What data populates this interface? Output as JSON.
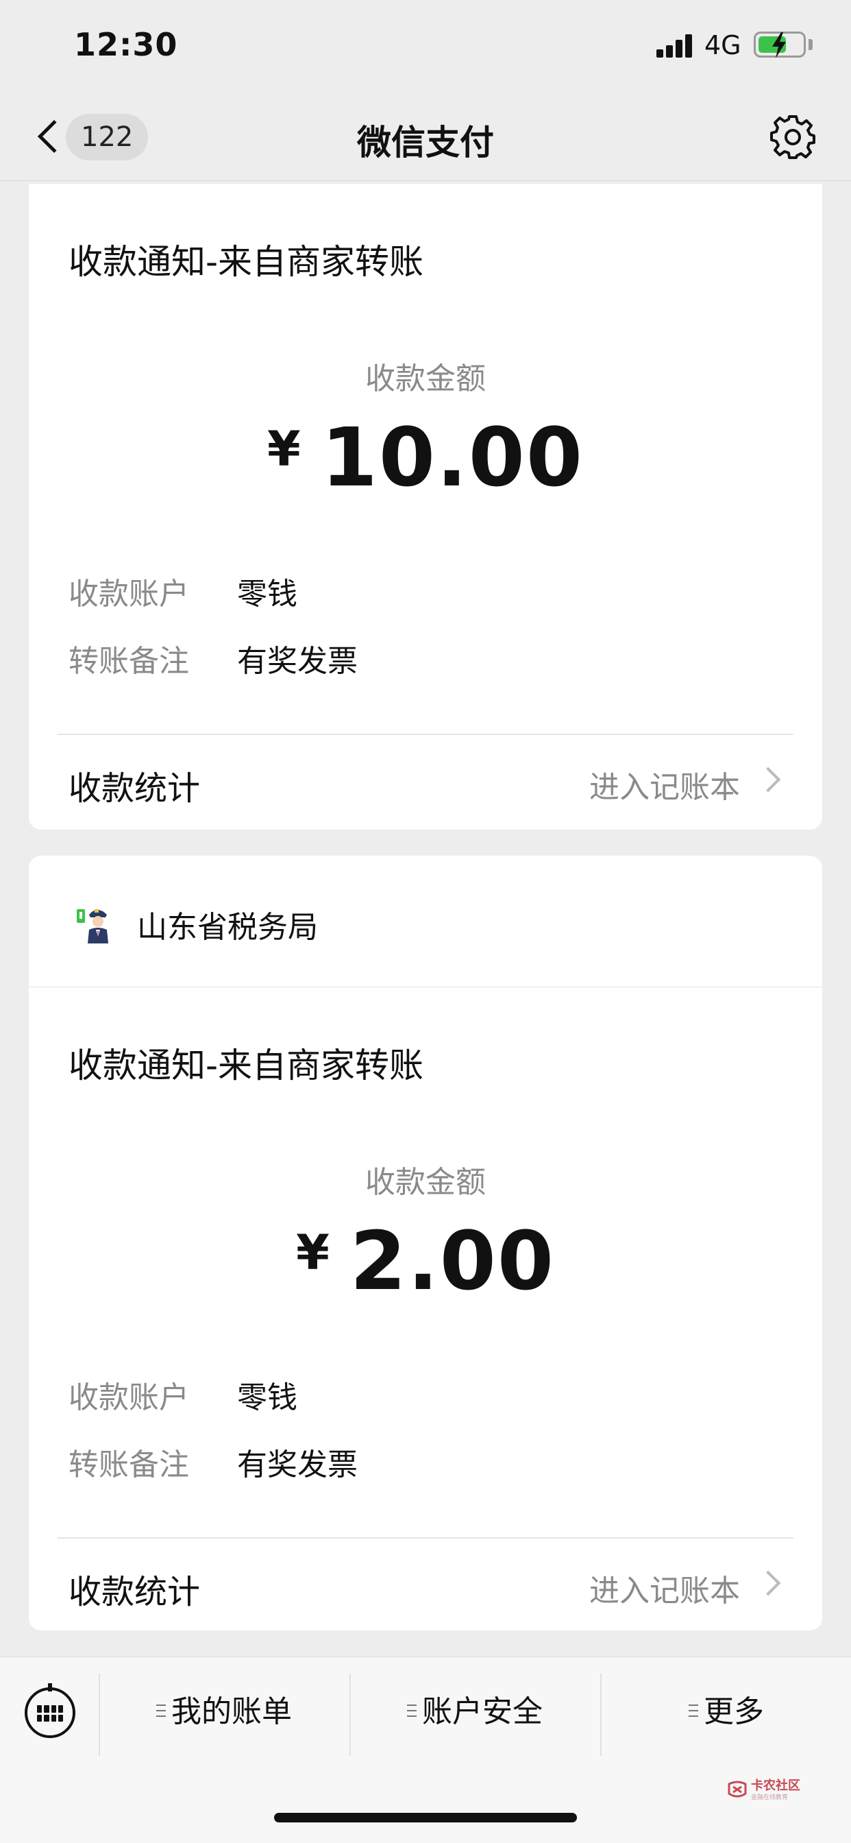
{
  "status_bar": {
    "time": "12:30",
    "network": "4G"
  },
  "nav": {
    "back_count": "122",
    "title": "微信支付"
  },
  "cards": [
    {
      "notice_title": "收款通知-来自商家转账",
      "amount_label": "收款金额",
      "currency": "¥",
      "amount": "10.00",
      "account_label": "收款账户",
      "account_value": "零钱",
      "memo_label": "转账备注",
      "memo_value": "有奖发票",
      "stats_label": "收款统计",
      "stats_link": "进入记账本"
    },
    {
      "merchant_name": "山东省税务局",
      "notice_title": "收款通知-来自商家转账",
      "amount_label": "收款金额",
      "currency": "¥",
      "amount": "2.00",
      "account_label": "收款账户",
      "account_value": "零钱",
      "memo_label": "转账备注",
      "memo_value": "有奖发票",
      "stats_label": "收款统计",
      "stats_link": "进入记账本"
    }
  ],
  "bottom_menu": {
    "items": [
      "我的账单",
      "账户安全",
      "更多"
    ]
  },
  "watermark": {
    "text": "卡农社区",
    "sub": "金融在线教育"
  },
  "colors": {
    "background": "#ededed",
    "battery": "#3cc24a",
    "secondary_text": "#8a8a8a"
  }
}
